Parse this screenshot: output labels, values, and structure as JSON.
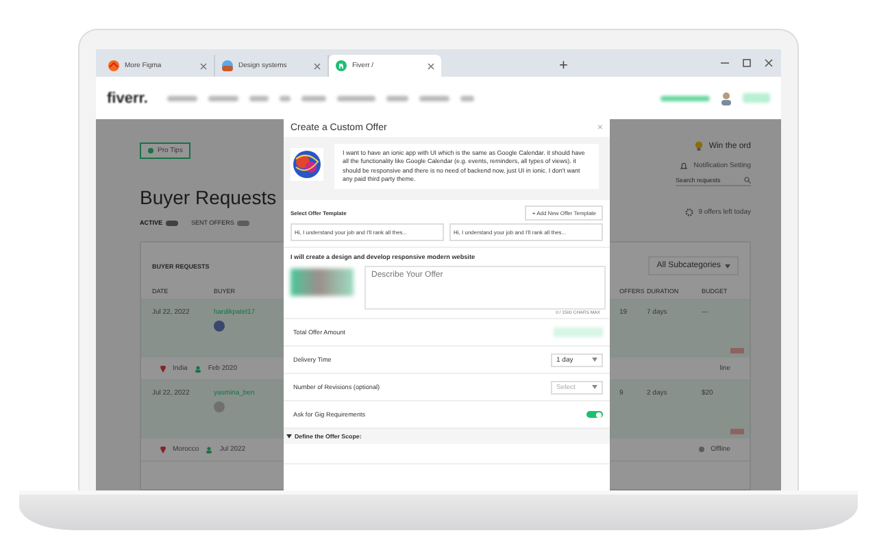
{
  "browser": {
    "tabs": [
      {
        "title": "More Figma",
        "selected": false
      },
      {
        "title": "Design systems",
        "selected": false
      },
      {
        "title": "Fiverr /",
        "selected": true
      }
    ],
    "new_tab": "+"
  },
  "site": {
    "logo": "fiverr."
  },
  "page": {
    "pro_tips": "Pro Tips",
    "heading": "Buyer Requests",
    "tabs": [
      {
        "label": "ACTIVE",
        "selected": true
      },
      {
        "label": "SENT OFFERS",
        "selected": false
      }
    ],
    "tip": "Win the ord",
    "notification": "Notification Setting",
    "search": {
      "placeholder": "Search requests"
    },
    "offers_left": "9 offers left today",
    "table": {
      "title": "BUYER REQUESTS",
      "filter": "All Subcategories",
      "columns": [
        "DATE",
        "BUYER",
        "OFFERS",
        "DURATION",
        "BUDGET"
      ],
      "rows": [
        {
          "date": "Jul 22, 2022",
          "buyer": "hardikpatel17",
          "offers": "19",
          "duration": "7 days",
          "budget": "---",
          "country": "India",
          "joined": "Feb 2020",
          "status": "line"
        },
        {
          "date": "Jul 22, 2022",
          "buyer": "yasmina_ben",
          "offers": "9",
          "duration": "2 days",
          "budget": "$20",
          "country": "Morocco",
          "joined": "Jul 2022",
          "status": "Offline"
        }
      ]
    }
  },
  "modal": {
    "title": "Create a Custom Offer",
    "close": "×",
    "request": "I want to have an ionic app with UI which is the same as Google Calendar. it should have all the functionality like Google Calendar (e.g. events, reminders, all types of views). it should be responsive and there is no need of backend now, just UI in ionic. I don't want any paid third party theme.",
    "template_label": "Select Offer Template",
    "add_template": "+ Add New Offer Template",
    "templates": [
      "Hi, I understand your job and I'll rank all thes...",
      "Hi, I understand your job and I'll rank all thes..."
    ],
    "gig_title": "I will create a design and develop responsive modern website",
    "description": {
      "placeholder": "Describe Your Offer"
    },
    "char_count": "0 / 1500 CHARS MAX",
    "fields": [
      {
        "kind": "amount",
        "label": "Total Offer Amount"
      },
      {
        "kind": "select",
        "label": "Delivery Time",
        "value": "1 day"
      },
      {
        "kind": "select",
        "label": "Number of Revisions (optional)",
        "value": "Select",
        "placeholder_style": true
      },
      {
        "kind": "toggle",
        "label": "Ask for Gig Requirements",
        "on": true
      }
    ],
    "scope": "Define the Offer Scope:"
  }
}
